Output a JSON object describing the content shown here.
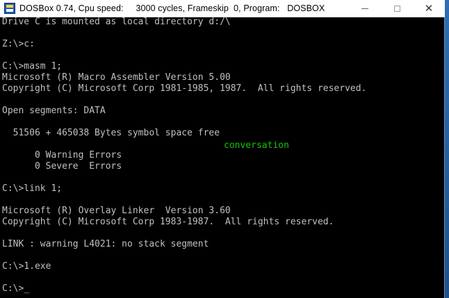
{
  "window": {
    "title": "DOSBox 0.74, Cpu speed:     3000 cycles, Frameskip  0, Program:   DOSBOX",
    "icon": "dosbox-icon",
    "controls": {
      "minimize": "minimize-icon",
      "maximize": "maximize-icon",
      "close": "close-icon"
    }
  },
  "console": {
    "lines": [
      "Drive C is mounted as local directory d:/\\",
      "",
      "Z:\\>c:",
      "",
      "C:\\>masm 1;",
      "Microsoft (R) Macro Assembler Version 5.00",
      "Copyright (C) Microsoft Corp 1981-1985, 1987.  All rights reserved.",
      "",
      "Open segments: DATA",
      "",
      "  51506 + 465038 Bytes symbol space free",
      "",
      "      0 Warning Errors",
      "      0 Severe  Errors",
      "",
      "C:\\>link 1;",
      "",
      "Microsoft (R) Overlay Linker  Version 3.60",
      "Copyright (C) Microsoft Corp 1983-1987.  All rights reserved.",
      "",
      "LINK : warning L4021: no stack segment",
      "",
      "C:\\>1.exe",
      "",
      "C:\\>"
    ],
    "cursor": "_",
    "overlay_text": "conversation",
    "colors": {
      "background": "#000000",
      "text": "#c0c0c0",
      "overlay": "#16c60c"
    }
  }
}
